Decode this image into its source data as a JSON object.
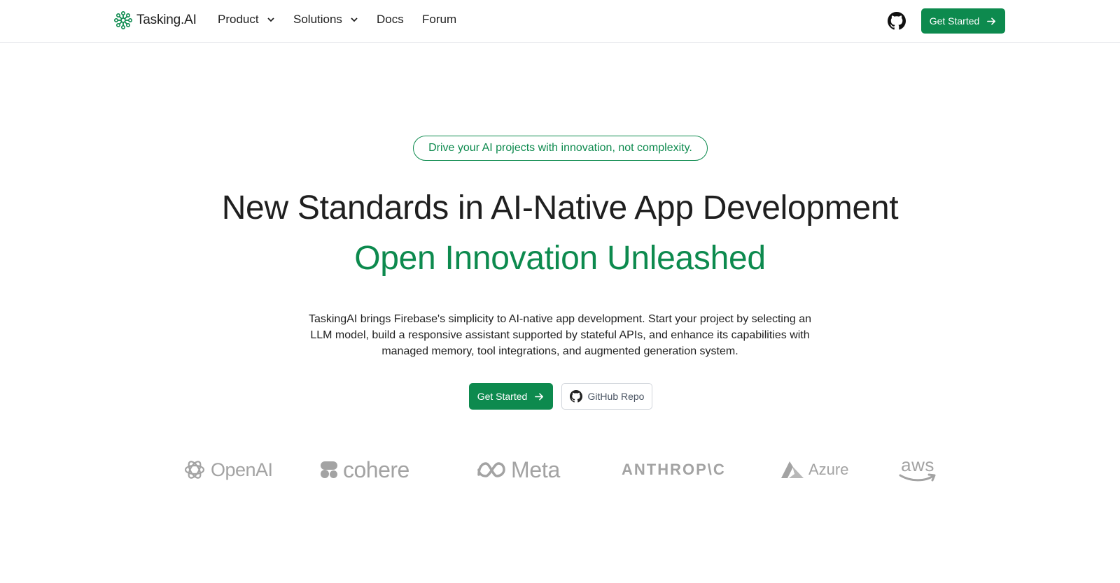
{
  "nav": {
    "brand": "Tasking.AI",
    "items": [
      {
        "label": "Product"
      },
      {
        "label": "Solutions"
      },
      {
        "label": "Docs"
      },
      {
        "label": "Forum"
      }
    ],
    "cta_label": "Get Started"
  },
  "hero": {
    "badge": "Drive your AI projects with innovation, not complexity.",
    "title": "New Standards in AI-Native App Development",
    "subtitle": "Open Innovation Unleashed",
    "description": "TaskingAI brings Firebase's simplicity to AI-native app development. Start your project by selecting an LLM model, build a responsive assistant supported by stateful APIs, and enhance its capabilities with managed memory, tool integrations, and augmented generation system.",
    "primary_button": "Get Started",
    "secondary_button": "GitHub Repo"
  },
  "partners": [
    {
      "name": "OpenAI"
    },
    {
      "name": "cohere"
    },
    {
      "name": "Meta"
    },
    {
      "name": "ANTHROP\\C"
    },
    {
      "name": "Azure"
    },
    {
      "name": "aws"
    }
  ],
  "colors": {
    "brand_green": "#0d8a4e",
    "logo_gray": "#a3a3a3"
  }
}
